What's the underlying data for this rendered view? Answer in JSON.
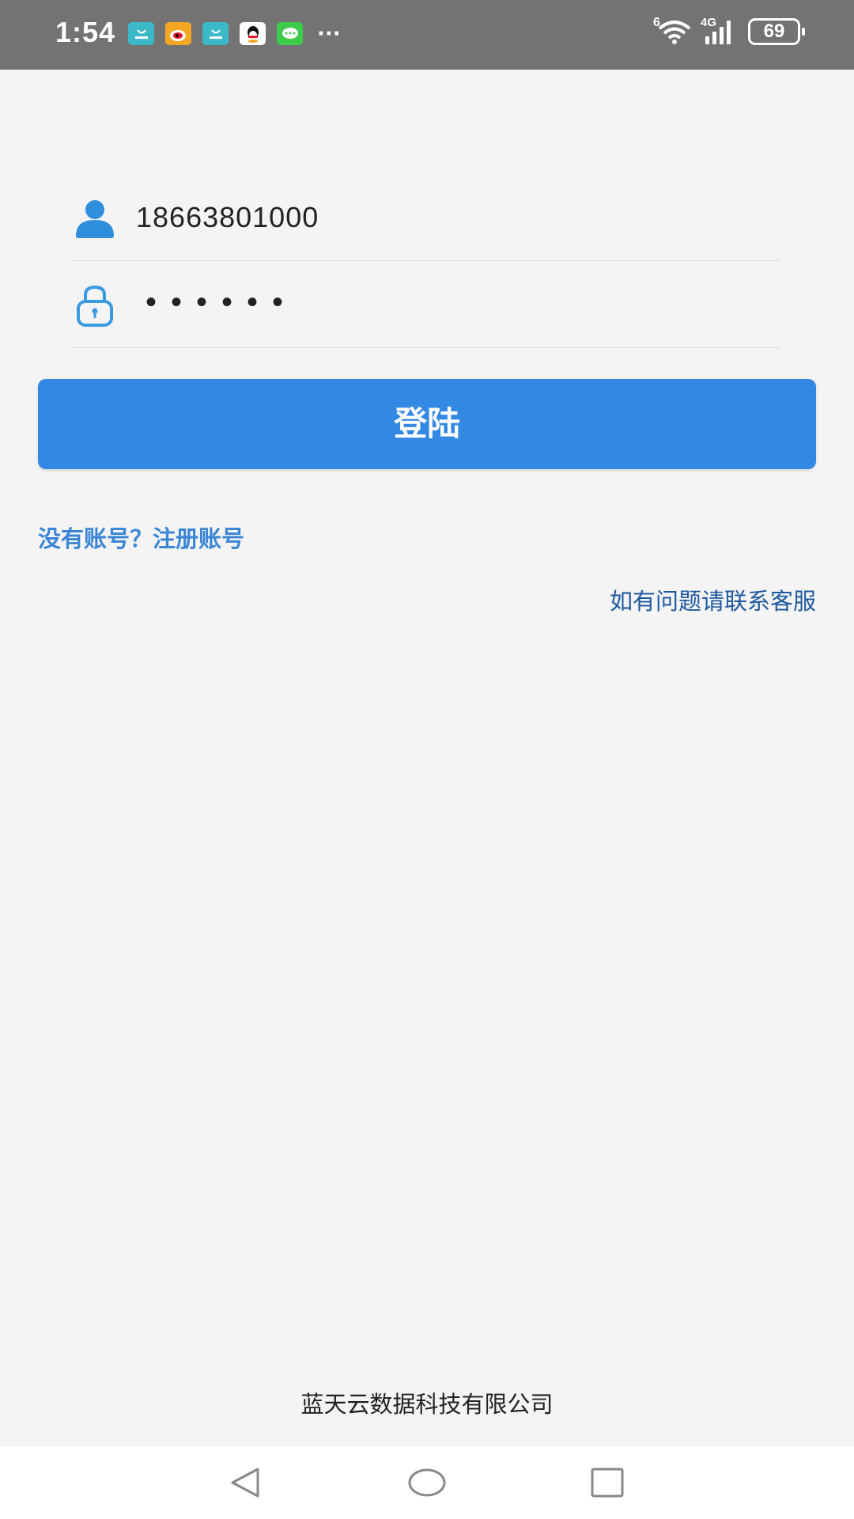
{
  "status_bar": {
    "time": "1:54",
    "notifications": [
      {
        "icon": "store-icon",
        "color": "#3bb9c9"
      },
      {
        "icon": "weibo-icon",
        "color": "#f5a623"
      },
      {
        "icon": "store-icon",
        "color": "#3bb9c9"
      },
      {
        "icon": "qq-icon",
        "color": "#ffffff"
      },
      {
        "icon": "message-icon",
        "color": "#3ecb4a"
      }
    ],
    "more": "···",
    "wifi_label": "6",
    "network_label": "4G",
    "battery": "69"
  },
  "login_form": {
    "username_value": "18663801000",
    "password_mask": "••••••",
    "login_button_label": "登陆",
    "accent_color": "#3388e3"
  },
  "links": {
    "register": "没有账号？注册账号",
    "support": "如有问题请联系客服"
  },
  "footer": {
    "company": "蓝天云数据科技有限公司"
  },
  "nav": {
    "back": "back-icon",
    "home": "home-icon",
    "recents": "recents-icon"
  }
}
